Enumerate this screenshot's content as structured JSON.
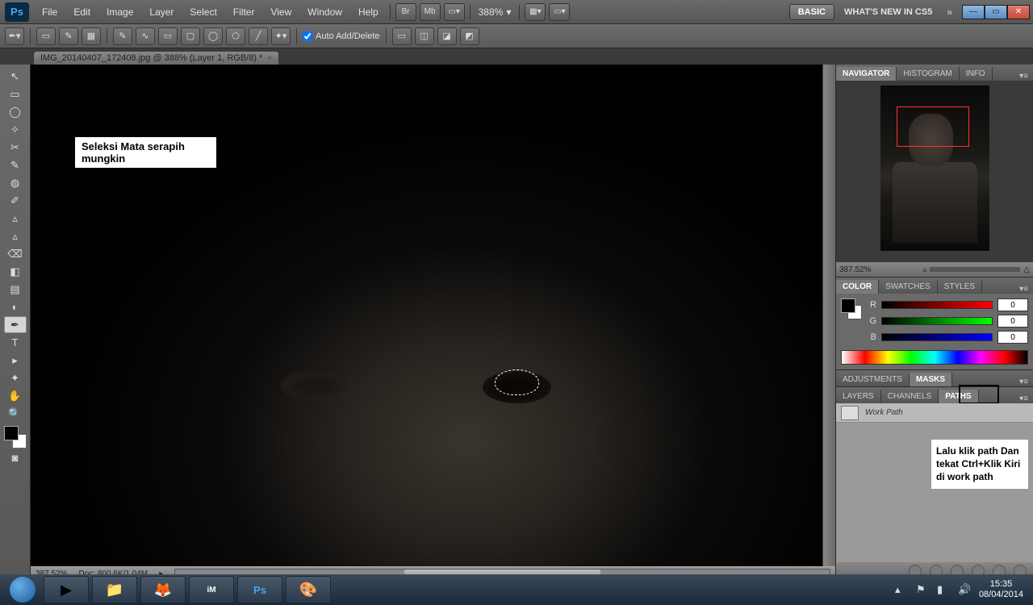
{
  "app": {
    "logo": "Ps"
  },
  "menu": [
    "File",
    "Edit",
    "Image",
    "Layer",
    "Select",
    "Filter",
    "View",
    "Window",
    "Help"
  ],
  "zoom_dropdown": "388%",
  "top_right": {
    "basic": "BASIC",
    "whatsnew": "WHAT'S NEW IN CS5"
  },
  "options": {
    "auto_add_delete": "Auto Add/Delete"
  },
  "document": {
    "tab_title": "IMG_20140407_172408.jpg @ 388% (Layer 1, RGB/8) *"
  },
  "annotations": {
    "canvas_note": "Seleksi Mata serapih mungkin",
    "paths_note": "Lalu klik path Dan tekat Ctrl+Klik Kiri di work path"
  },
  "status": {
    "zoom": "387,52%",
    "doc": "Doc: 800,6K/1,04M"
  },
  "panels": {
    "nav": {
      "tabs": [
        "NAVIGATOR",
        "HISTOGRAM",
        "INFO"
      ],
      "zoom": "387.52%"
    },
    "color": {
      "tabs": [
        "COLOR",
        "SWATCHES",
        "STYLES"
      ],
      "channels": [
        {
          "label": "R",
          "value": "0"
        },
        {
          "label": "G",
          "value": "0"
        },
        {
          "label": "B",
          "value": "0"
        }
      ]
    },
    "adj": {
      "tabs": [
        "ADJUSTMENTS",
        "MASKS"
      ]
    },
    "layers": {
      "tabs": [
        "LAYERS",
        "CHANNELS",
        "PATHS"
      ],
      "work_path": "Work Path"
    }
  },
  "tools": [
    "↖",
    "▭",
    "◯",
    "✧",
    "✂",
    "✎",
    "◍",
    "✐",
    "▵",
    "⌫",
    "◧",
    "▤",
    "◐",
    "T",
    "▸",
    "✦",
    "✋",
    "🔍"
  ],
  "taskbar": {
    "items": [
      "▶",
      "📁",
      "🦊",
      "iM",
      "Ps",
      "🎨"
    ],
    "time": "15:35",
    "date": "08/04/2014"
  }
}
